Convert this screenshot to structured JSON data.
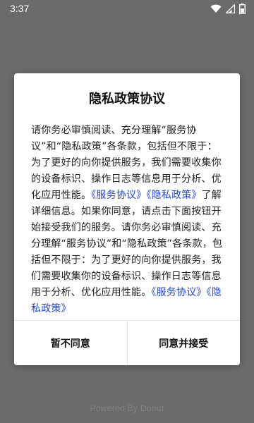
{
  "status_bar": {
    "time": "3:37",
    "icons": [
      "wifi-icon",
      "signal-icon",
      "battery-icon"
    ]
  },
  "dialog": {
    "title": "隐私政策协议",
    "body": {
      "text_1": "请你务必审慎阅读、充分理解“服务协议”和“隐私政策”各条款，包括但不限于：为了更好的向你提供服务，我们需要收集你的设备标识、操作日志等信息用于分析、优化应用性能。",
      "link_1": "《服务协议》",
      "link_2": "《隐私政策》",
      "text_2": "了解详细信息。如果你同意，请点击下面按钮开始接受我们的服务。请你务必审慎阅读、充分理解“服务协议”和“隐私政策”各条款，包括但不限于：为了更好的向你提供服务，我们需要收集你的设备标识、操作日志等信息用于分析、优化应用性能。",
      "link_3": "《服务协议》",
      "link_4": "《隐私政策》"
    },
    "actions": {
      "decline_label": "暂不同意",
      "accept_label": "同意并接受"
    }
  },
  "footer": {
    "text": "Powered By Donut"
  },
  "colors": {
    "overlay": "#6b6b6b",
    "link": "#2346d6",
    "dialog_bg": "#ffffff"
  }
}
